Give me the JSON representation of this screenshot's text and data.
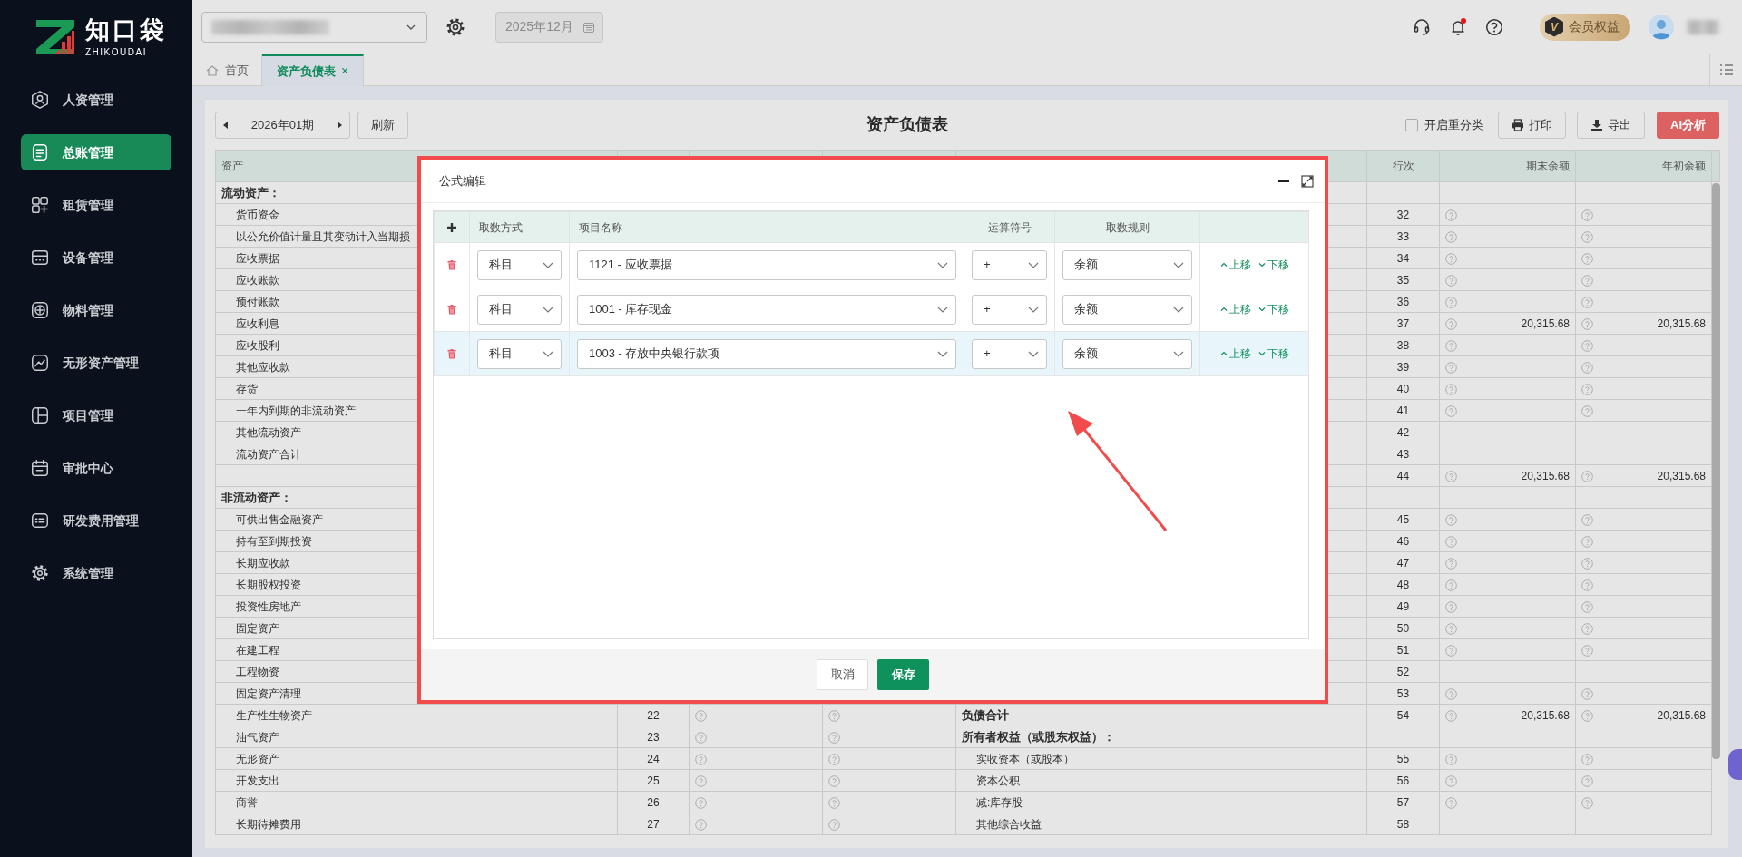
{
  "brand": {
    "name": "知口袋",
    "tagline": "ZHIKOUDAI"
  },
  "sidebar": {
    "items": [
      {
        "label": "人资管理",
        "selected": false
      },
      {
        "label": "总账管理",
        "selected": true
      },
      {
        "label": "租赁管理",
        "selected": false
      },
      {
        "label": "设备管理",
        "selected": false
      },
      {
        "label": "物料管理",
        "selected": false
      },
      {
        "label": "无形资产管理",
        "selected": false
      },
      {
        "label": "项目管理",
        "selected": false
      },
      {
        "label": "审批中心",
        "selected": false
      },
      {
        "label": "研发费用管理",
        "selected": false
      },
      {
        "label": "系统管理",
        "selected": false
      }
    ]
  },
  "topbar": {
    "date": "2025年12月",
    "unread": true,
    "member": {
      "mark": "V",
      "label": "会员权益"
    }
  },
  "tabs": [
    {
      "label": "首页",
      "selected": false
    },
    {
      "label": "资产负债表",
      "selected": true,
      "close": "×"
    }
  ],
  "toolbar": {
    "period": "2026年01期",
    "refresh": "刷新",
    "title": "资产负债表",
    "reclassify": {
      "label": "开启重分类",
      "checked": false
    },
    "print": "打印",
    "export": "导出",
    "ai": "AI分析"
  },
  "table": {
    "header": {
      "assets": "资产",
      "r_line": "行次",
      "r_closing": "期末余额",
      "r_opening": "年初余额"
    },
    "rows": [
      {
        "name": "流动资产：",
        "kind": "section"
      },
      {
        "name": "货币资金",
        "kind": "item",
        "r_line": "32",
        "r_formula": true
      },
      {
        "name": "以公允价值计量且其变动计入当期损",
        "kind": "item",
        "r_line": "33",
        "r_formula": true
      },
      {
        "name": "应收票据",
        "kind": "item",
        "r_line": "34",
        "r_formula": true
      },
      {
        "name": "应收账款",
        "kind": "item",
        "r_line": "35",
        "r_formula": true
      },
      {
        "name": "预付账款",
        "kind": "item",
        "r_line": "36",
        "r_formula": true
      },
      {
        "name": "应收利息",
        "kind": "item",
        "r_line": "37",
        "r_formula": true,
        "r_closing": "20,315.68",
        "r_opening": "20,315.68"
      },
      {
        "name": "应收股利",
        "kind": "item",
        "r_line": "38",
        "r_formula": true
      },
      {
        "name": "其他应收款",
        "kind": "item",
        "r_line": "39",
        "r_formula": true
      },
      {
        "name": "存货",
        "kind": "item",
        "r_line": "40",
        "r_formula": true
      },
      {
        "name": "一年内到期的非流动资产",
        "kind": "item",
        "r_line": "41",
        "r_formula": true
      },
      {
        "name": "其他流动资产",
        "kind": "item",
        "r_line": "42",
        "r_formula": false
      },
      {
        "name": "流动资产合计",
        "kind": "item",
        "r_line": "43",
        "r_formula": false
      },
      {
        "r_line": "44",
        "r_formula": true,
        "r_closing": "20,315.68",
        "r_opening": "20,315.68"
      },
      {
        "name": "非流动资产：",
        "kind": "section"
      },
      {
        "name": "可供出售金融资产",
        "kind": "item",
        "r_line": "45",
        "r_formula": true
      },
      {
        "name": "持有至到期投资",
        "kind": "item",
        "r_line": "46",
        "r_formula": true
      },
      {
        "name": "长期应收款",
        "kind": "item",
        "r_line": "47",
        "r_formula": true
      },
      {
        "name": "长期股权投资",
        "kind": "item",
        "r_line": "48",
        "r_formula": true
      },
      {
        "name": "投资性房地产",
        "kind": "item",
        "r_line": "49",
        "r_formula": true
      },
      {
        "name": "固定资产",
        "kind": "item",
        "r_line": "50",
        "r_formula": true
      },
      {
        "name": "在建工程",
        "kind": "item",
        "r_line": "51",
        "r_formula": true
      },
      {
        "name": "工程物资",
        "kind": "item",
        "r_line": "52",
        "r_formula": false
      },
      {
        "name": "固定资产清理",
        "kind": "item",
        "r_line": "53",
        "r_formula": true
      },
      {
        "name": "生产性生物资产",
        "kind": "item",
        "line": "22",
        "formula": true,
        "r_name": "负债合计",
        "r_section": true,
        "r_line": "54",
        "r_formula": true,
        "r_closing": "20,315.68",
        "r_opening": "20,315.68"
      },
      {
        "name": "油气资产",
        "kind": "item",
        "line": "23",
        "formula": true,
        "r_name": "所有者权益（或股东权益）：",
        "r_section": true
      },
      {
        "name": "无形资产",
        "kind": "item",
        "line": "24",
        "formula": true,
        "r_name": "实收资本（或股本）",
        "r_section": false,
        "r_line": "55",
        "r_formula": true
      },
      {
        "name": "开发支出",
        "kind": "item",
        "line": "25",
        "formula": true,
        "r_name": "资本公积",
        "r_section": false,
        "r_line": "56",
        "r_formula": true
      },
      {
        "name": "商誉",
        "kind": "item",
        "line": "26",
        "formula": true,
        "r_name": "减:库存股",
        "r_section": false,
        "r_line": "57",
        "r_formula": true
      },
      {
        "name": "长期待摊费用",
        "kind": "item",
        "line": "27",
        "formula": true,
        "r_name": "其他综合收益",
        "r_section": false,
        "r_line": "58",
        "r_formula": false
      }
    ]
  },
  "modal": {
    "title": "公式编辑",
    "columns": [
      "取数方式",
      "项目名称",
      "运算符号",
      "取数规则"
    ],
    "rows": [
      {
        "method": "科目",
        "item": "1121 - 应收票据",
        "operator": "+",
        "rule": "余额",
        "up": "上移",
        "down": "下移",
        "selected": false
      },
      {
        "method": "科目",
        "item": "1001 - 库存现金",
        "operator": "+",
        "rule": "余额",
        "up": "上移",
        "down": "下移",
        "selected": false
      },
      {
        "method": "科目",
        "item": "1003 - 存放中央银行款项",
        "operator": "+",
        "rule": "余额",
        "up": "上移",
        "down": "下移",
        "selected": true
      }
    ],
    "cancel": "取消",
    "save": "保存"
  }
}
